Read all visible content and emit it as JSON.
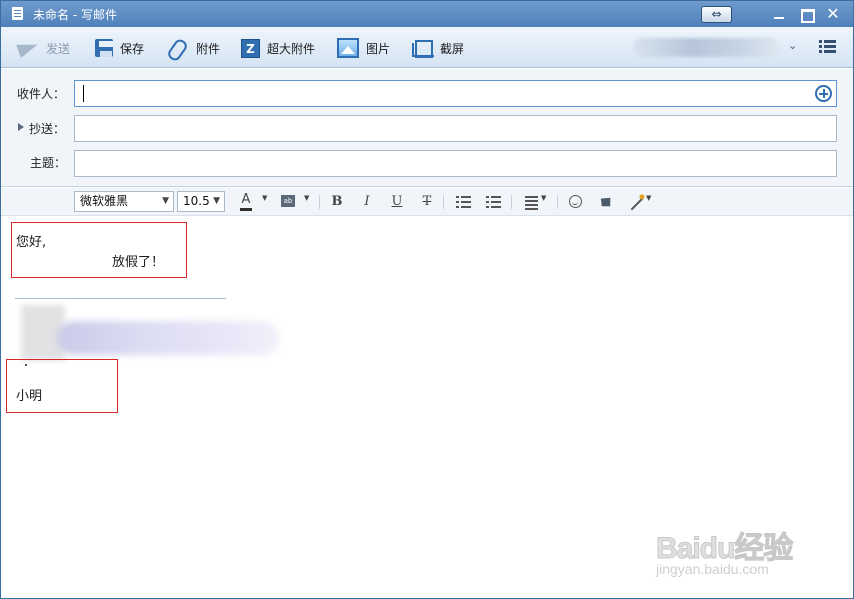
{
  "window": {
    "title": "未命名 - 写邮件",
    "resize_glyph": "⇔",
    "close_glyph": "✕"
  },
  "toolbar": {
    "send_label": "发送",
    "save_label": "保存",
    "attach_label": "附件",
    "big_attach_label": "超大附件",
    "big_attach_icon_letter": "Z",
    "picture_label": "图片",
    "screenshot_label": "截屏",
    "account_chevron": "⌄"
  },
  "fields": {
    "to_label": "收件人：",
    "cc_label": "抄送：",
    "subject_label": "主题："
  },
  "format": {
    "font_name": "微软雅黑",
    "font_size": "10.5",
    "font_color_glyph": "A",
    "highlight_glyph": "ab",
    "bold": "B",
    "italic": "I",
    "underline": "U",
    "strike": "T"
  },
  "body": {
    "greeting": "您好,",
    "message": "放假了！",
    "signature_name": "小明"
  },
  "watermark": {
    "logo": "Baidu经验",
    "url": "jingyan.baidu.com"
  },
  "colors": {
    "title_bar": "#5a89c2",
    "highlight_box": "#d62a2a",
    "accent_icon": "#2f6eb0"
  }
}
